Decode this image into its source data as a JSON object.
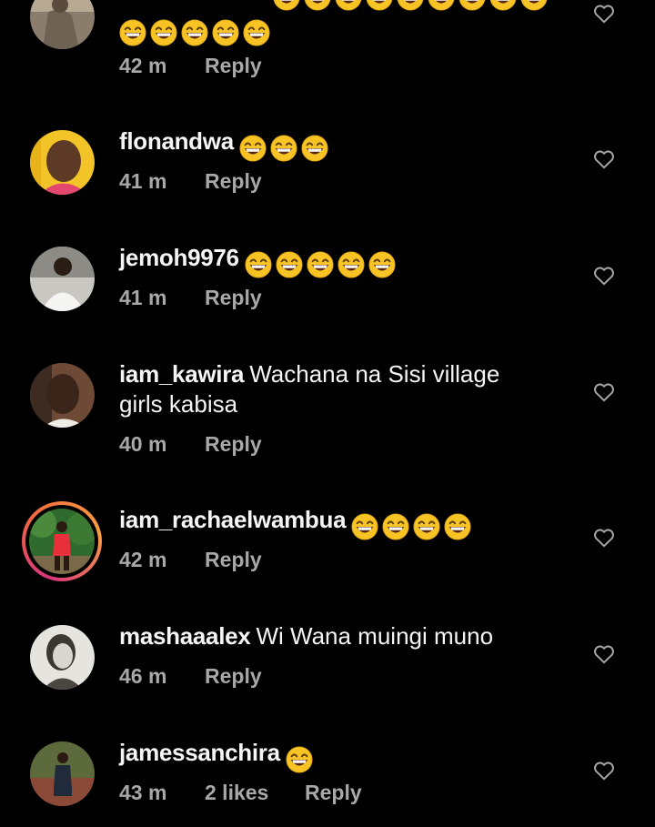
{
  "colors": {
    "background": "#000000",
    "text": "#f5f5f5",
    "meta": "#a8a8a8",
    "emoji_face": "#f7c325"
  },
  "comments": [
    {
      "username": "",
      "text": "",
      "emoji_count": 5,
      "time": "42 m",
      "likes": "",
      "reply_label": "Reply",
      "icon": "heart-outline-icon"
    },
    {
      "username": "flonandwa",
      "text": "",
      "emoji_count": 3,
      "time": "41 m",
      "likes": "",
      "reply_label": "Reply",
      "icon": "heart-outline-icon"
    },
    {
      "username": "jemoh9976",
      "text": "",
      "emoji_count": 5,
      "time": "41 m",
      "likes": "",
      "reply_label": "Reply",
      "icon": "heart-outline-icon"
    },
    {
      "username": "iam_kawira",
      "text": "Wachana na Sisi village girls kabisa",
      "emoji_count": 0,
      "time": "40 m",
      "likes": "",
      "reply_label": "Reply",
      "icon": "heart-outline-icon"
    },
    {
      "username": "iam_rachaelwambua",
      "text": "",
      "emoji_count": 4,
      "time": "42 m",
      "likes": "",
      "reply_label": "Reply",
      "icon": "heart-outline-icon"
    },
    {
      "username": "mashaaalex",
      "text": "Wi Wana muingi muno",
      "emoji_count": 0,
      "time": "46 m",
      "likes": "",
      "reply_label": "Reply",
      "icon": "heart-outline-icon"
    },
    {
      "username": "jamessanchira",
      "text": "",
      "emoji_count": 1,
      "time": "43 m",
      "likes": "2 likes",
      "reply_label": "Reply",
      "icon": "heart-outline-icon"
    }
  ]
}
